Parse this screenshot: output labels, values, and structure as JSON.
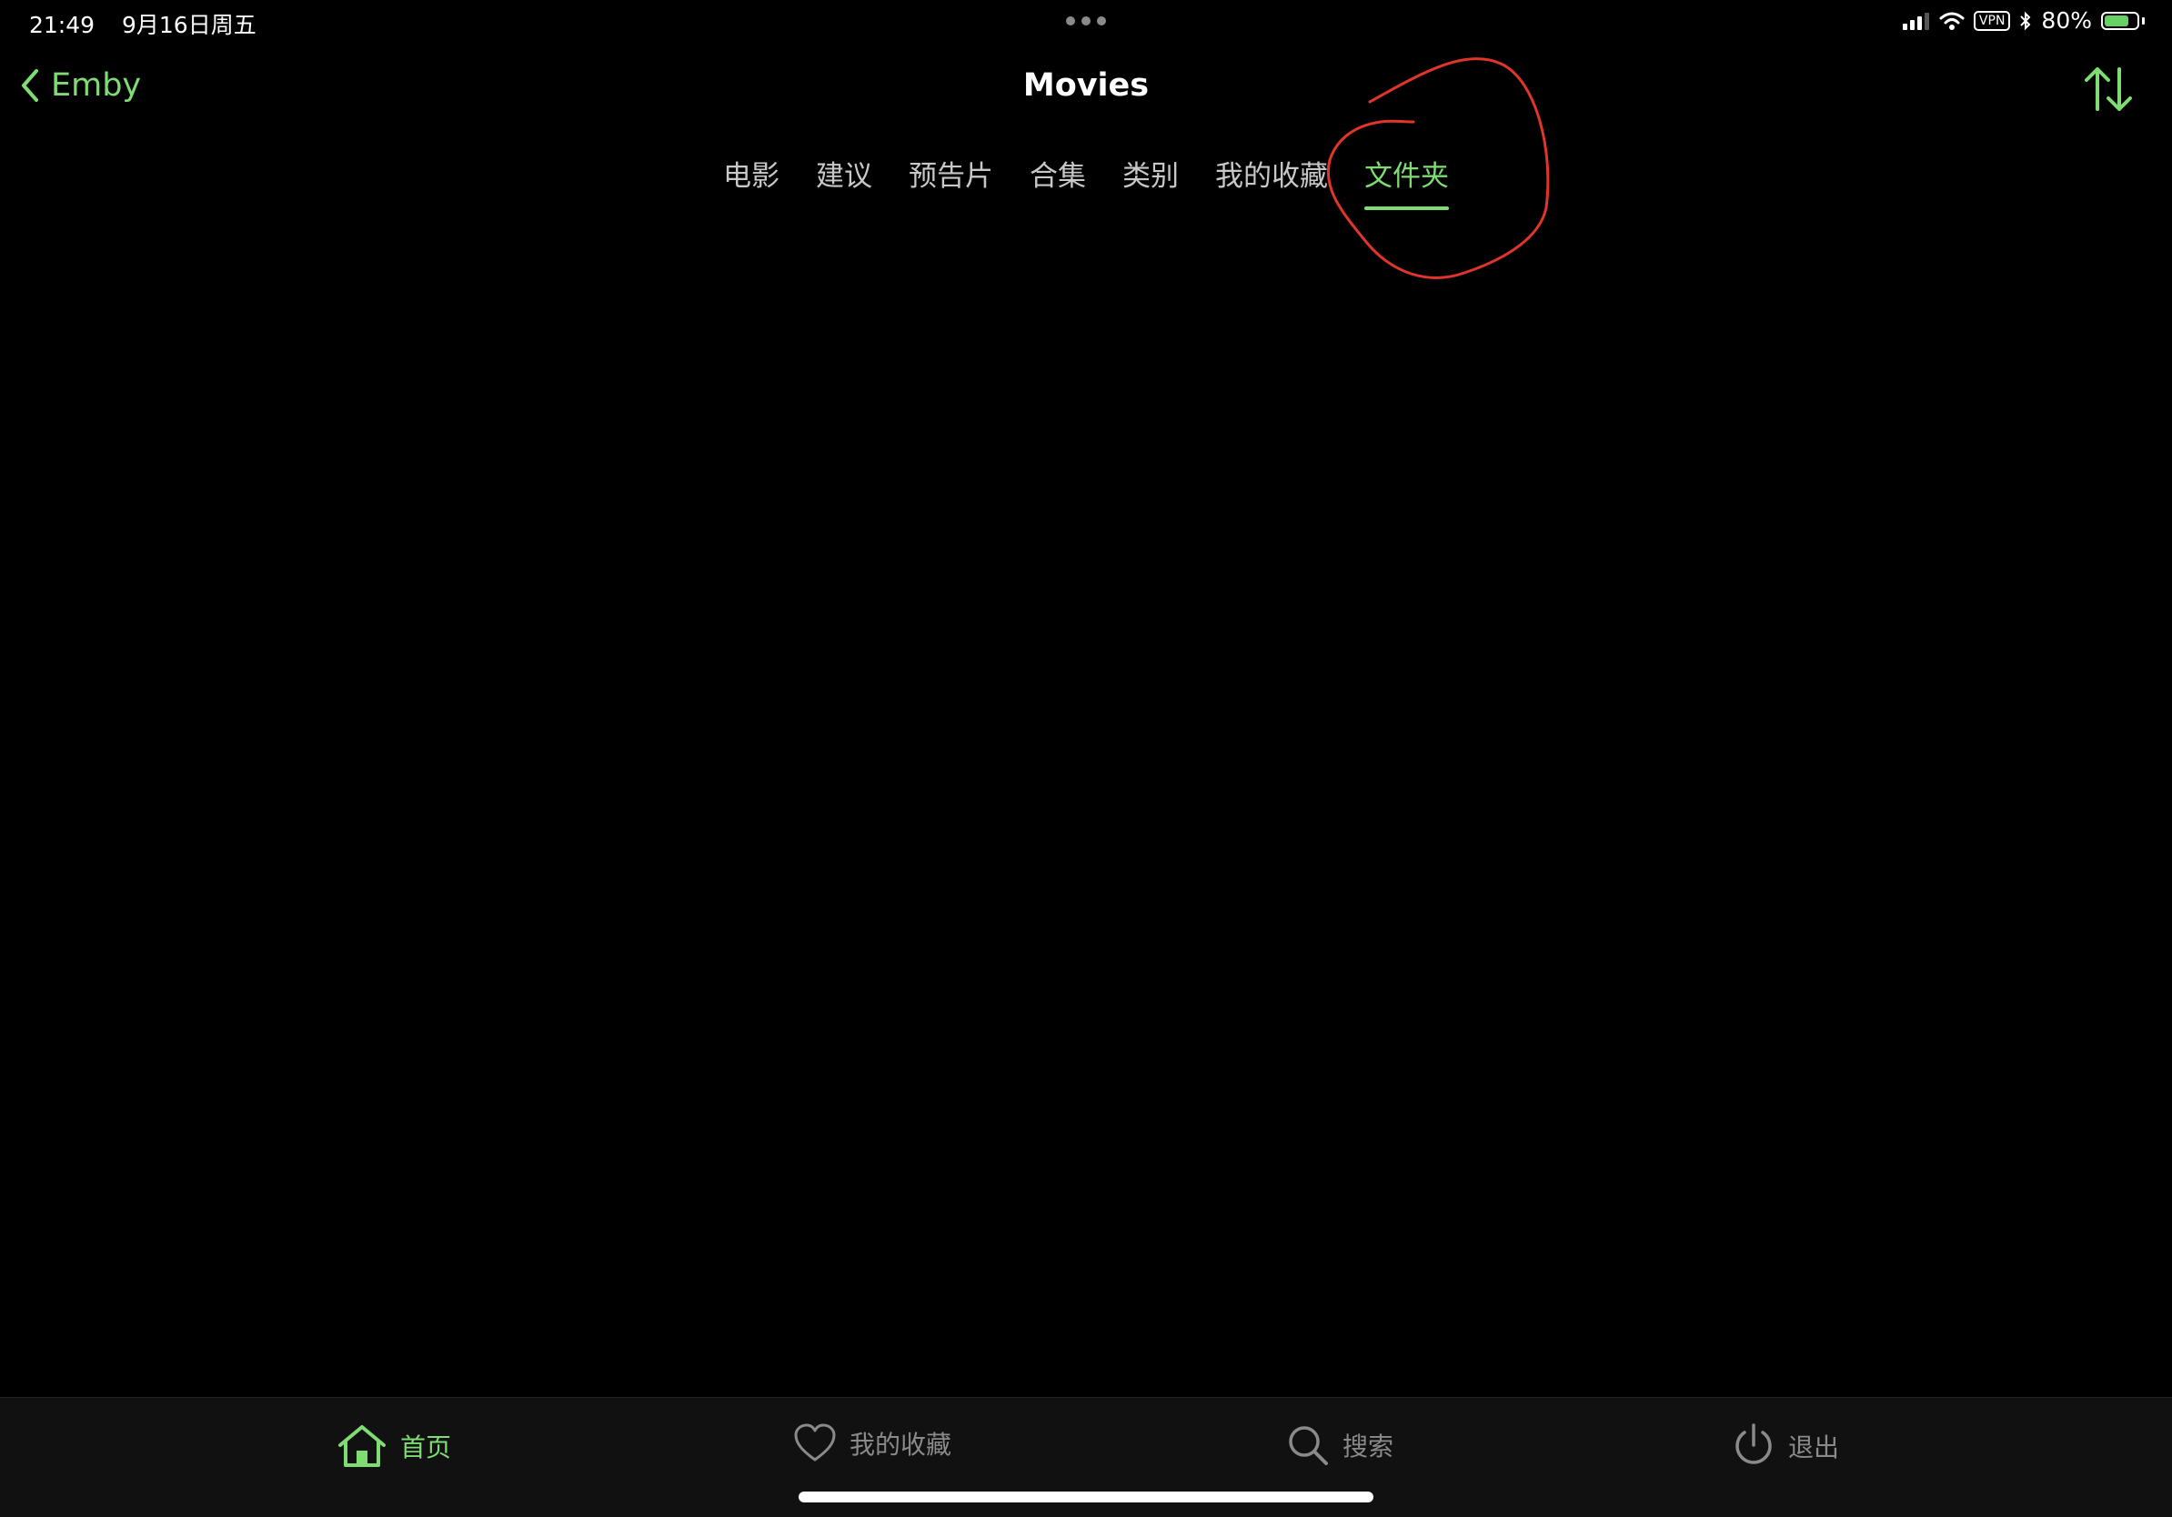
{
  "status_bar": {
    "time": "21:49",
    "date": "9月16日周五",
    "vpn": "VPN",
    "battery": "80%",
    "battery_level": 0.8
  },
  "nav": {
    "back_label": "Emby",
    "title": "Movies"
  },
  "tabs": [
    {
      "label": "电影",
      "active": false
    },
    {
      "label": "建议",
      "active": false
    },
    {
      "label": "预告片",
      "active": false
    },
    {
      "label": "合集",
      "active": false
    },
    {
      "label": "类别",
      "active": false
    },
    {
      "label": "我的收藏",
      "active": false
    },
    {
      "label": "文件夹",
      "active": true
    }
  ],
  "tab_bar": {
    "home": "首页",
    "favorites": "我的收藏",
    "search": "搜索",
    "logout": "退出"
  },
  "colors": {
    "accent": "#7fdc73",
    "annotation": "#e0352b",
    "inactive": "#8a8a8a",
    "background": "#000000"
  }
}
